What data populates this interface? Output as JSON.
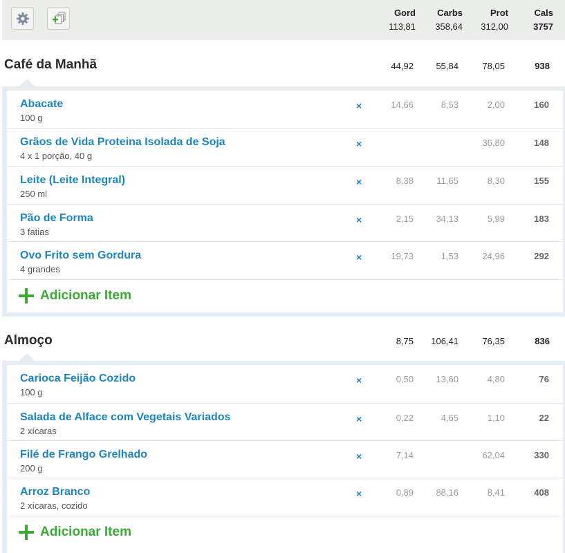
{
  "header": {
    "settings_icon": "gear-icon",
    "copy_icon": "add-copy-icon",
    "columns": {
      "fat": "Gord",
      "carbs": "Carbs",
      "prot": "Prot",
      "cals": "Cals"
    },
    "totals": {
      "fat": "113,81",
      "carbs": "358,64",
      "prot": "312,00",
      "cals": "3757"
    }
  },
  "meals": [
    {
      "title": "Café da Manhã",
      "totals": {
        "fat": "44,92",
        "carbs": "55,84",
        "prot": "78,05",
        "cals": "938"
      },
      "items": [
        {
          "name": "Abacate",
          "portion": "100 g",
          "fat": "14,66",
          "carbs": "8,53",
          "prot": "2,00",
          "cals": "160"
        },
        {
          "name": "Grãos de Vida Proteina Isolada de Soja",
          "portion": "4 x 1 porção, 40 g",
          "fat": "",
          "carbs": "",
          "prot": "36,80",
          "cals": "148"
        },
        {
          "name": "Leite (Leite Integral)",
          "portion": "250 ml",
          "fat": "8,38",
          "carbs": "11,65",
          "prot": "8,30",
          "cals": "155"
        },
        {
          "name": "Pão de Forma",
          "portion": "3 fatias",
          "fat": "2,15",
          "carbs": "34,13",
          "prot": "5,99",
          "cals": "183"
        },
        {
          "name": "Ovo Frito sem Gordura",
          "portion": "4 grandes",
          "fat": "19,73",
          "carbs": "1,53",
          "prot": "24,96",
          "cals": "292"
        }
      ],
      "delete_glyph": "×",
      "add_label": "Adicionar Item"
    },
    {
      "title": "Almoço",
      "totals": {
        "fat": "8,75",
        "carbs": "106,41",
        "prot": "76,35",
        "cals": "836"
      },
      "items": [
        {
          "name": "Carioca Feijão Cozido",
          "portion": "100 g",
          "fat": "0,50",
          "carbs": "13,60",
          "prot": "4,80",
          "cals": "76"
        },
        {
          "name": "Salada de Alface com Vegetais Variados",
          "portion": "2 xícaras",
          "fat": "0,22",
          "carbs": "4,65",
          "prot": "1,10",
          "cals": "22"
        },
        {
          "name": "Filé de Frango Grelhado",
          "portion": "200 g",
          "fat": "7,14",
          "carbs": "",
          "prot": "62,04",
          "cals": "330"
        },
        {
          "name": "Arroz Branco",
          "portion": "2 xícaras, cozido",
          "fat": "0,89",
          "carbs": "88,16",
          "prot": "8,41",
          "cals": "408"
        }
      ],
      "delete_glyph": "×",
      "add_label": "Adicionar Item"
    }
  ],
  "colors": {
    "link": "#1d85bd",
    "add_green": "#3aaa35",
    "header_bg": "#ebedea",
    "panel_bg": "#e6ecf3"
  }
}
